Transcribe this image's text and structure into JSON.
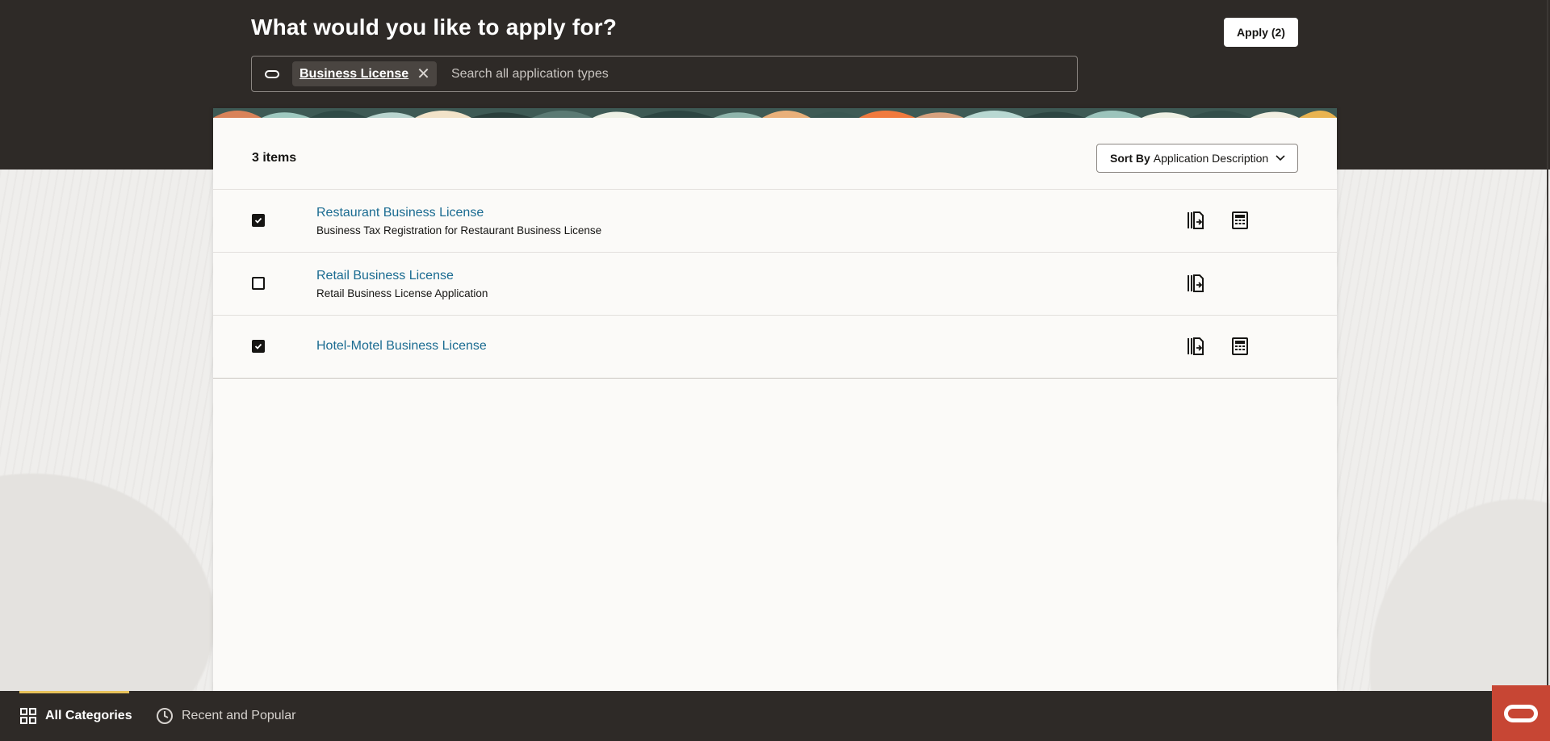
{
  "header": {
    "title": "What would you like to apply for?",
    "apply_button_label": "Apply (2)"
  },
  "search": {
    "filter_chip_label": "Business License",
    "placeholder": "Search all application types",
    "value": ""
  },
  "results": {
    "count_label": "3 items",
    "sort": {
      "prefix": "Sort By",
      "selected": "Application Description"
    },
    "items": [
      {
        "title": "Restaurant Business License",
        "description": "Business Tax Registration for Restaurant Business License",
        "checked": true,
        "actions": [
          "apply-form-icon",
          "fee-calculator-icon"
        ]
      },
      {
        "title": "Retail Business License",
        "description": "Retail Business License Application",
        "checked": false,
        "actions": [
          "apply-form-icon"
        ]
      },
      {
        "title": "Hotel-Motel Business License",
        "description": "",
        "checked": true,
        "actions": [
          "apply-form-icon",
          "fee-calculator-icon"
        ]
      }
    ]
  },
  "bottom_nav": {
    "tabs": [
      {
        "label": "All Categories",
        "icon": "grid-icon",
        "active": true
      },
      {
        "label": "Recent and Popular",
        "icon": "clock-icon",
        "active": false
      }
    ]
  },
  "colors": {
    "header_bg": "#2e2a27",
    "link": "#1a6b91",
    "accent_tab": "#e8c25a",
    "oracle_red": "#c74634"
  }
}
